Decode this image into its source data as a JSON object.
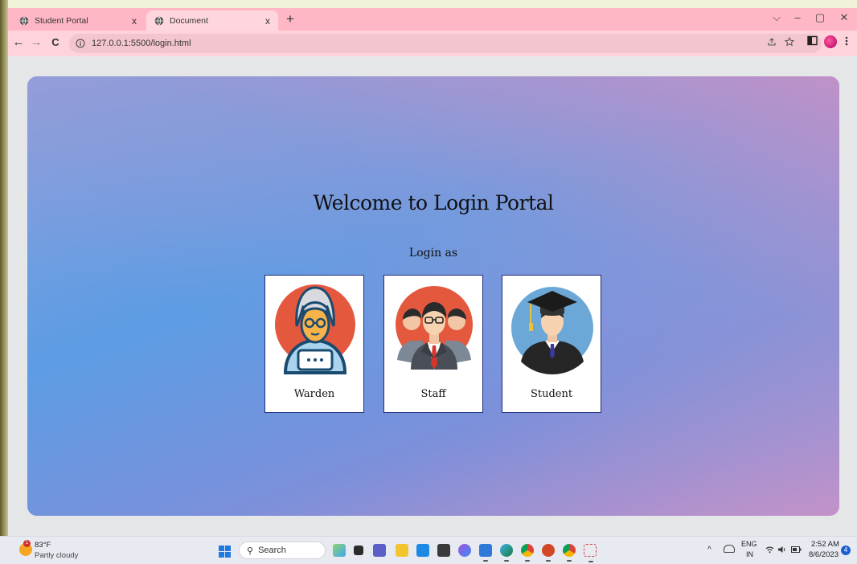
{
  "browser": {
    "tabs": [
      {
        "title": "Student Portal",
        "active": false
      },
      {
        "title": "Document",
        "active": true
      }
    ],
    "tab_close_glyph": "x",
    "new_tab_glyph": "+",
    "window_controls": {
      "dropdown": "⌵",
      "minimize": "–",
      "restore": "▢",
      "close": "✕"
    },
    "url": "127.0.0.1:5500/login.html",
    "nav": {
      "back": "←",
      "forward": "→",
      "reload": "C"
    }
  },
  "page": {
    "heading": "Welcome to Login Portal",
    "subheading": "Login as",
    "roles": [
      {
        "label": "Warden",
        "icon": "warden-avatar-icon"
      },
      {
        "label": "Staff",
        "icon": "staff-group-icon"
      },
      {
        "label": "Student",
        "icon": "graduate-student-icon"
      }
    ]
  },
  "taskbar": {
    "weather": {
      "temp": "83°F",
      "condition": "Partly cloudy",
      "badge": "1"
    },
    "search_placeholder": "Search",
    "tray": {
      "lang_top": "ENG",
      "lang_bottom": "IN",
      "time": "2:52 AM",
      "date": "8/6/2023",
      "notifications": "4"
    }
  },
  "colors": {
    "tab_bar": "#ffb7c5",
    "toolbar": "#ffd3db",
    "hero_blue": "#5c9ce4",
    "hero_pink": "#c692c8",
    "card_border": "#1f2a7a"
  }
}
